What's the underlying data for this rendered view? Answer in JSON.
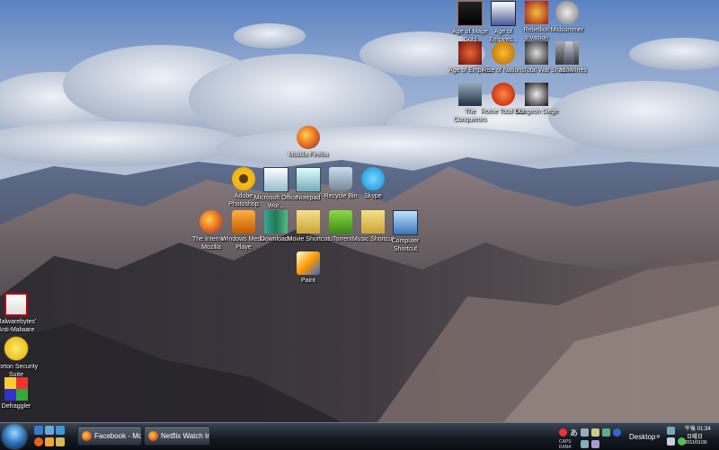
{
  "colors": {
    "sky_top": "#5f86c4",
    "cloud": "#e6ebf2",
    "mountain_dark": "#3d3a3e",
    "mountain_mid": "#7a6d70",
    "taskbar": "#141a22"
  },
  "desktop_icons": {
    "top_right": [
      {
        "label": "Age of Mage Gold",
        "icon": "warrior-icon"
      },
      {
        "label": "Age of Empires...",
        "icon": "knight-helmet-icon"
      },
      {
        "label": "Rebellion Invasion",
        "icon": "shield-crest-icon"
      },
      {
        "label": "Midsummer",
        "icon": "gear-ornament-icon"
      },
      {
        "label": "Age of Empires",
        "icon": "spartan-helmet-icon"
      },
      {
        "label": "Rise of Nations",
        "icon": "compass-medallion-icon"
      },
      {
        "label": "Total War",
        "icon": "total-war-icon"
      },
      {
        "label": "WAR",
        "icon": "warhammer-icon"
      },
      {
        "label": "Shadowlines",
        "icon": "tower-icon"
      },
      {
        "label": "The Conquerors",
        "icon": "hooded-figure-icon"
      },
      {
        "label": "Rome Total War",
        "icon": "rome-emblem-icon"
      },
      {
        "label": "Dungeon Siege",
        "icon": "dungeon-siege-icon"
      }
    ],
    "center": [
      {
        "label": "Mozilla Firefox",
        "icon": "firefox-icon"
      },
      {
        "label": "Adobe Photoshop",
        "icon": "sunflower-icon"
      },
      {
        "label": "Microsoft Office Wor...",
        "icon": "word-document-icon"
      },
      {
        "label": "Notepad",
        "icon": "notepad-icon"
      },
      {
        "label": "Recycle Bin",
        "icon": "recycle-bin-icon"
      },
      {
        "label": "Skype",
        "icon": "skype-icon"
      },
      {
        "label": "The Internet - Mozilla",
        "icon": "firefox-icon"
      },
      {
        "label": "Windows Media Playe",
        "icon": "media-player-icon"
      },
      {
        "label": "Downloads",
        "icon": "downloads-folder-icon"
      },
      {
        "label": "Movie Shortcut",
        "icon": "folder-icon"
      },
      {
        "label": "uTorrent",
        "icon": "utorrent-icon"
      },
      {
        "label": "Music Shortcut",
        "icon": "folder-icon"
      },
      {
        "label": "Computer Shortcut",
        "icon": "computer-icon"
      },
      {
        "label": "Paint",
        "icon": "paint-icon"
      }
    ],
    "left": [
      {
        "label": "Malwarebytes' Anti-Malware",
        "icon": "malwarebytes-icon"
      },
      {
        "label": "Norton Security Suite",
        "icon": "norton-icon"
      },
      {
        "label": "Defraggler",
        "icon": "defraggler-icon"
      }
    ]
  },
  "taskbar": {
    "tasks": [
      {
        "label": "Facebook - Mozill...",
        "icon": "firefox-icon"
      },
      {
        "label": "Netflix Watch Instan...",
        "icon": "firefox-icon"
      }
    ],
    "desktop_label": "Desktop",
    "time": "午後 01:34",
    "day": "日曜日",
    "date": "2011/01/30",
    "ime_label": "あ"
  }
}
